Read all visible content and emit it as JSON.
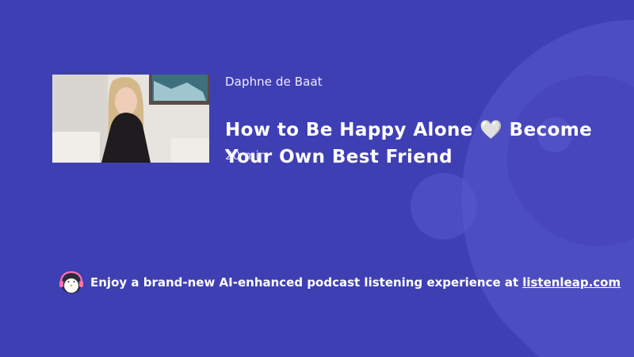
{
  "episode": {
    "author": "Daphne de Baat",
    "title": "How to Be Happy Alone 🤍 Become Your Own Best Friend",
    "duration": "20 min"
  },
  "promo": {
    "text": "Enjoy a brand-new AI-enhanced podcast listening experience at",
    "link_label": "listenleap.com"
  },
  "icons": {
    "mascot": "penguin-headphones-icon",
    "background": "listenleap-logo-watermark"
  },
  "colors": {
    "background": "#3f3fb4",
    "text": "#ffffff"
  }
}
